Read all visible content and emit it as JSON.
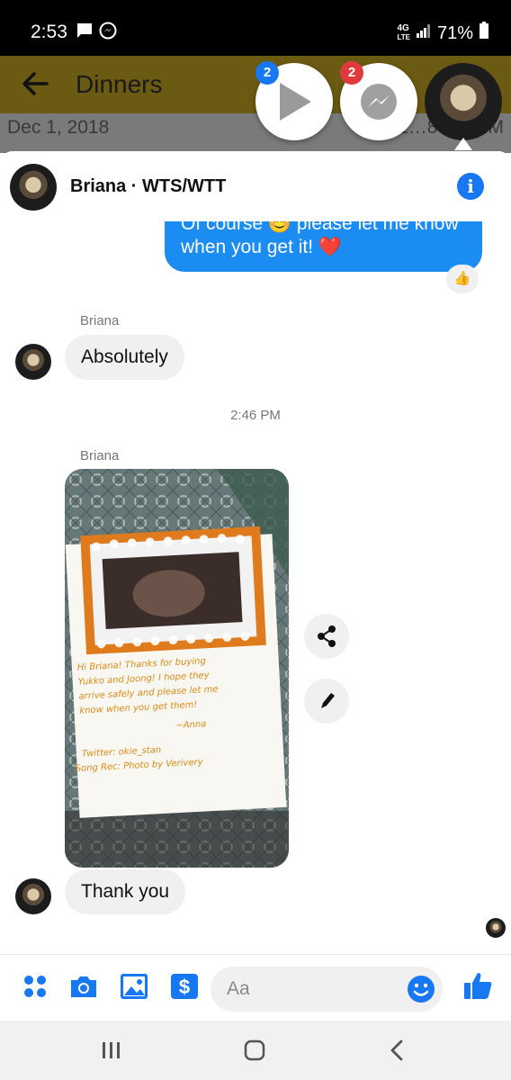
{
  "status_bar": {
    "time": "2:53",
    "network_top": "4G",
    "network_bottom": "LTE",
    "battery": "71%"
  },
  "background_app": {
    "title": "Dinners",
    "date_left": "Dec 1, 2018",
    "date_right": "1…8 10:…M"
  },
  "chat_heads": [
    {
      "name": "video-chat-head",
      "badge": "2"
    },
    {
      "name": "messenger-chat-head",
      "badge": "2"
    }
  ],
  "conversation": {
    "header_name": "Briana · WTS/WTT",
    "outgoing_message": "Of course 😊 please let me know when you get it! ❤️",
    "reaction": "👍",
    "messages": [
      {
        "sender": "Briana",
        "text": "Absolutely"
      },
      {
        "timestamp": "2:46 PM"
      },
      {
        "sender": "Briana",
        "image_note_lines": [
          "Hi Briana! Thanks for buying",
          "Yukko and Joong! I hope they",
          "arrive safely and please let me",
          "know when you get them!",
          "~Anna",
          "Twitter: okie_stan",
          "Song Rec: Photo by Verivery"
        ]
      },
      {
        "text": "Thank you"
      }
    ]
  },
  "composer": {
    "placeholder": "Aa"
  },
  "colors": {
    "accent": "#1877f2",
    "bubble_out": "#1b8cf2",
    "badge_red": "#e0393e",
    "badge_blue": "#1877f2"
  }
}
